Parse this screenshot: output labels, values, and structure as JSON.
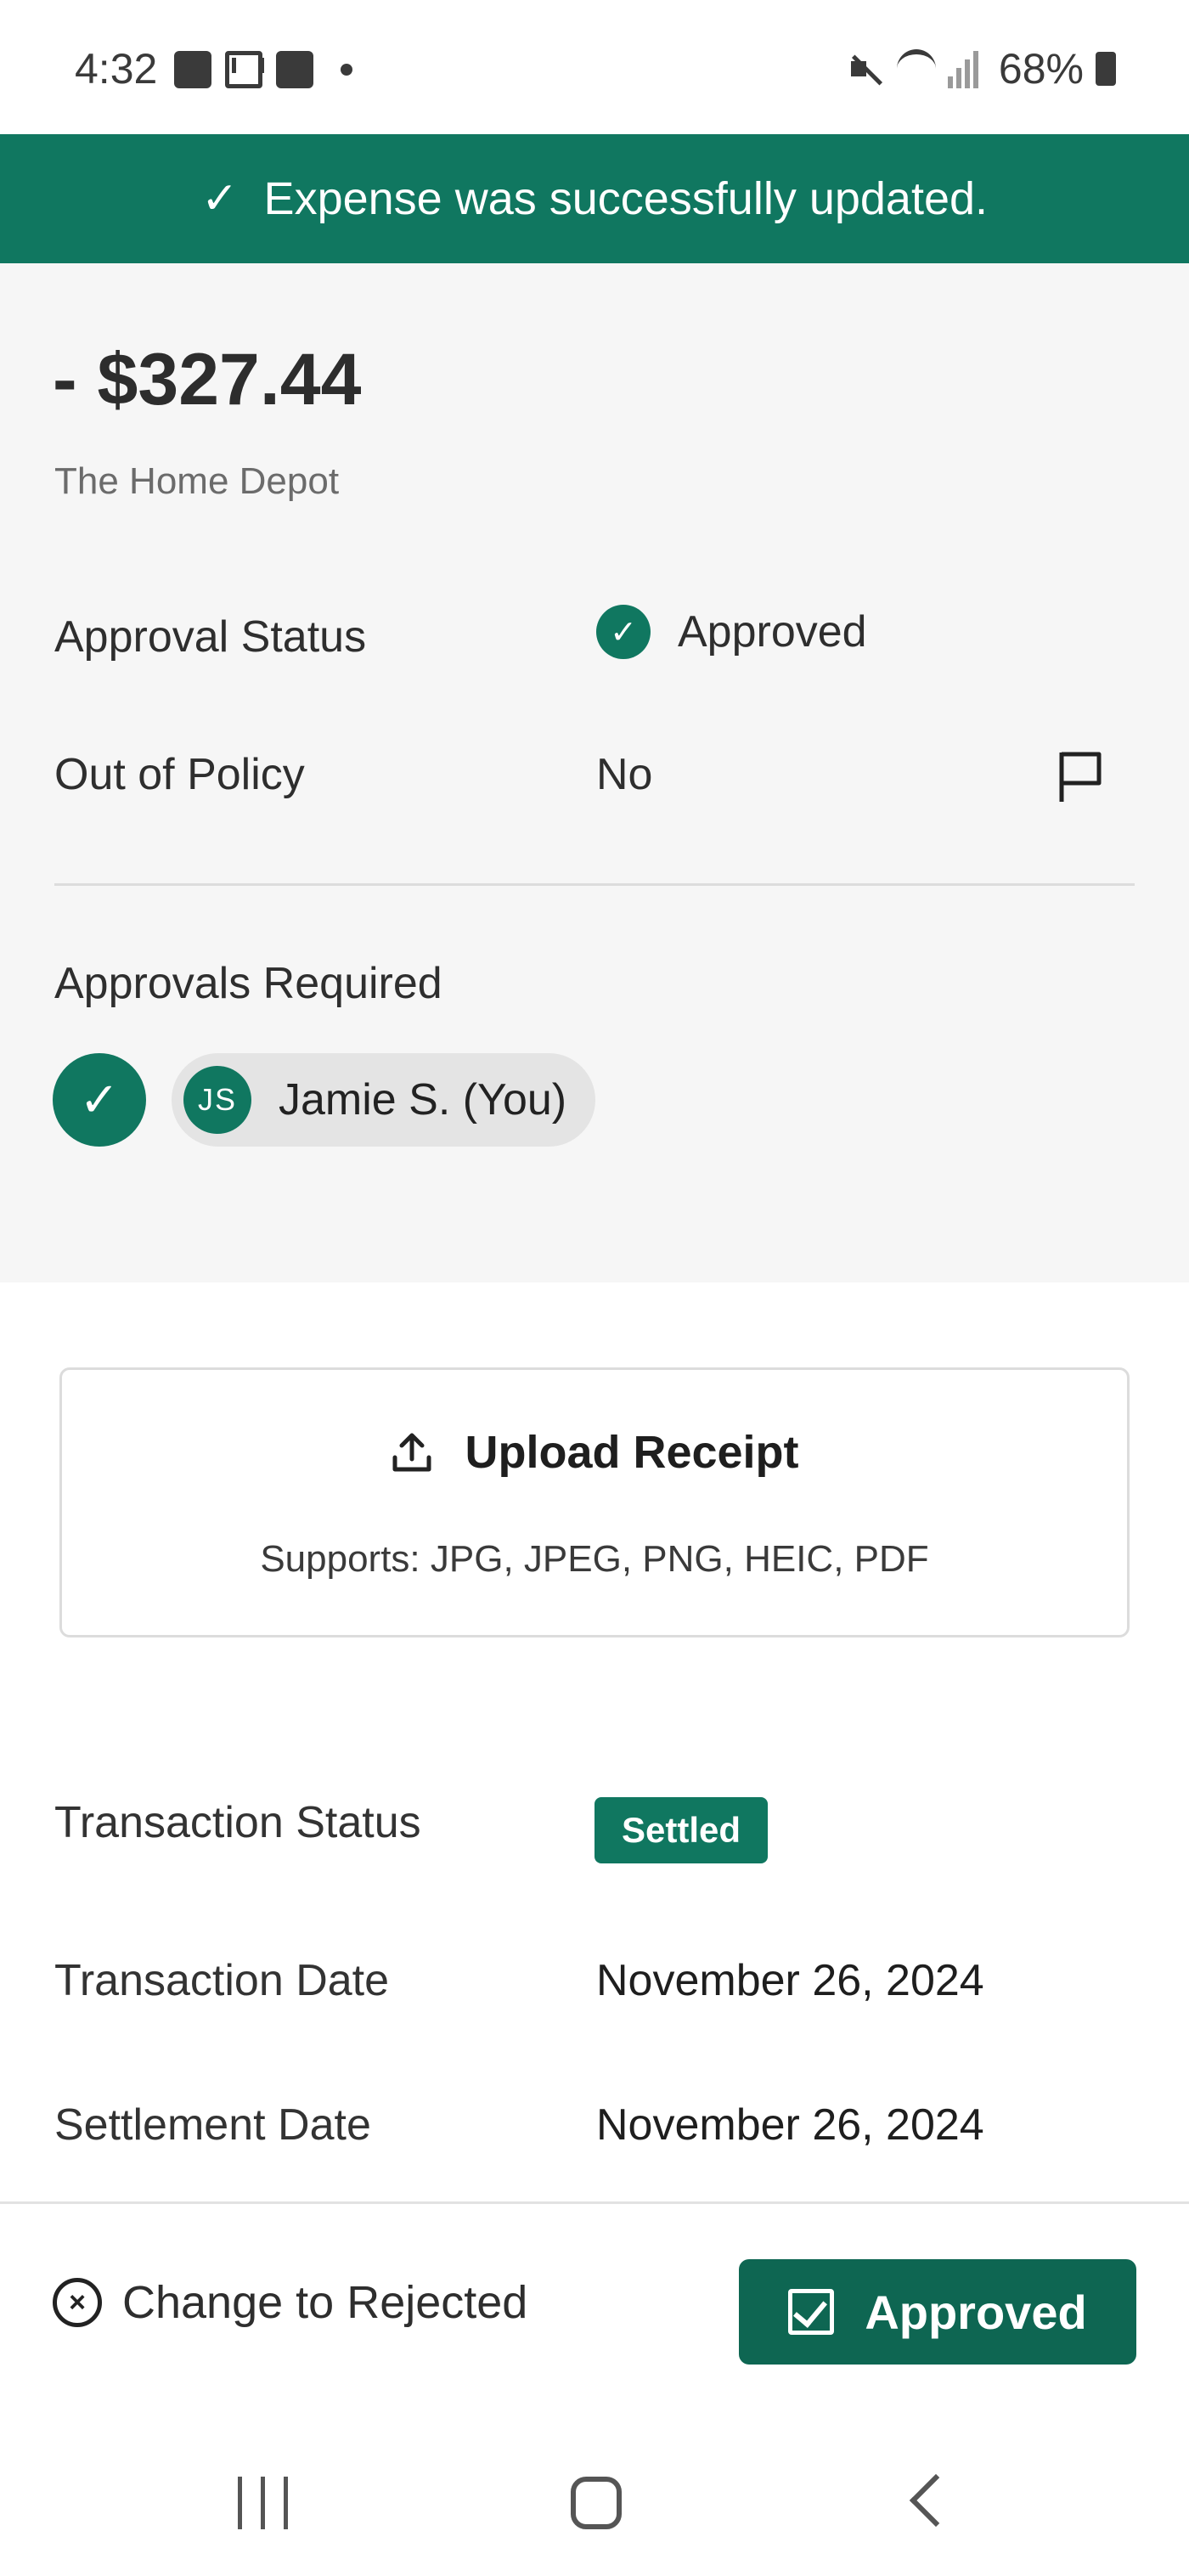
{
  "status_bar": {
    "time": "4:32",
    "battery": "68%"
  },
  "toast": {
    "message": "Expense was successfully updated."
  },
  "summary": {
    "amount": "- $327.44",
    "merchant": "The Home Depot",
    "approval_status_label": "Approval Status",
    "approval_status_value": "Approved",
    "out_of_policy_label": "Out of Policy",
    "out_of_policy_value": "No",
    "approvals_required_label": "Approvals Required",
    "approver_initials": "JS",
    "approver_name": "Jamie S. (You)"
  },
  "upload": {
    "title": "Upload Receipt",
    "supports": "Supports: JPG, JPEG, PNG, HEIC, PDF"
  },
  "details": {
    "transaction_status_label": "Transaction Status",
    "transaction_status_value": "Settled",
    "transaction_date_label": "Transaction Date",
    "transaction_date_value": "November 26, 2024",
    "settlement_date_label": "Settlement Date",
    "settlement_date_value": "November 26, 2024"
  },
  "actions": {
    "reject_label": "Change to Rejected",
    "approve_label": "Approved"
  },
  "colors": {
    "brand_green": "#107760",
    "button_green": "#0e6652"
  }
}
